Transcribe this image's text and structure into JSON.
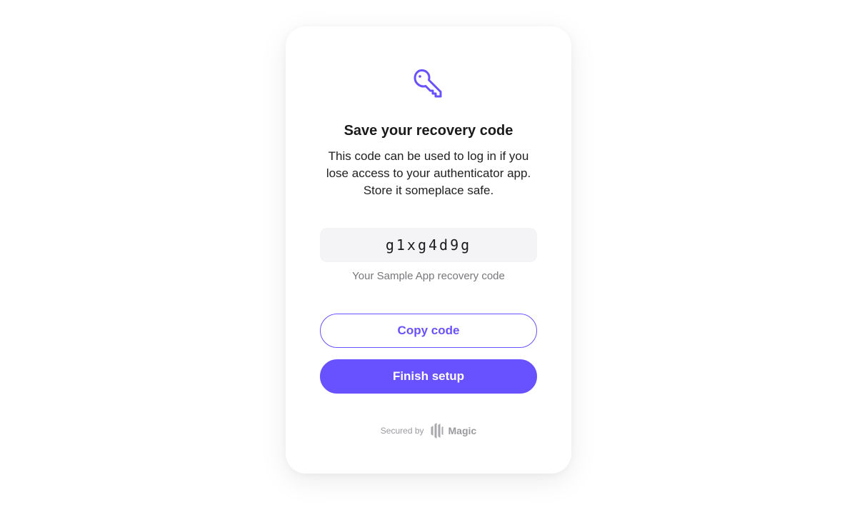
{
  "colors": {
    "accent": "#6851ff",
    "code_background": "#f4f4f6",
    "muted_text": "#77767a",
    "footer_gray": "#9a9a9e"
  },
  "header": {
    "icon": "key-icon",
    "title": "Save your recovery code"
  },
  "description": {
    "lines": [
      "This code can be used to log in if you",
      "lose access to your authenticator app.",
      "Store it someplace safe."
    ]
  },
  "recovery": {
    "code": "g1xg4d9g",
    "caption": "Your Sample App recovery code"
  },
  "actions": {
    "copy_label": "Copy code",
    "finish_label": "Finish setup"
  },
  "footer": {
    "secured_by": "Secured by",
    "brand_icon": "magic-logo-icon",
    "brand_name": "Magic"
  }
}
